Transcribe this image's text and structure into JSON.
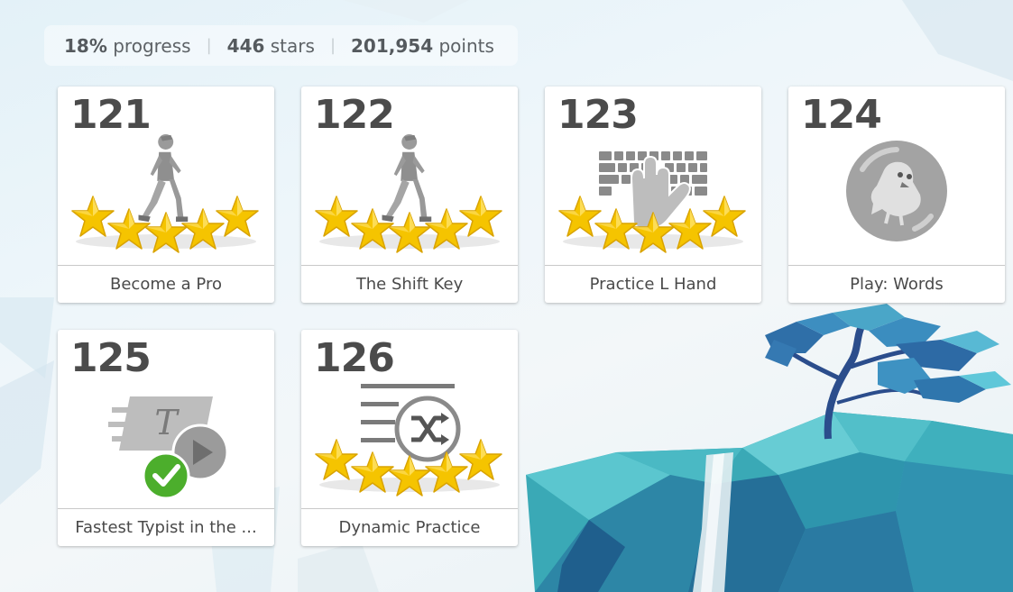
{
  "stats": {
    "progress_value": "18%",
    "progress_label": "progress",
    "stars_value": "446",
    "stars_label": "stars",
    "points_value": "201,954",
    "points_label": "points"
  },
  "lessons": [
    {
      "number": "121",
      "title": "Become a Pro",
      "icon": "walking-person-icon",
      "stars": 5
    },
    {
      "number": "122",
      "title": "The Shift Key",
      "icon": "walking-person-icon",
      "stars": 5
    },
    {
      "number": "123",
      "title": "Practice L Hand",
      "icon": "keyboard-hand-icon",
      "stars": 5
    },
    {
      "number": "124",
      "title": "Play: Words",
      "icon": "game-bird-icon",
      "stars": 0
    },
    {
      "number": "125",
      "title": "Fastest Typist in the ...",
      "icon": "typing-test-video-icon",
      "stars": 0,
      "completed": true
    },
    {
      "number": "126",
      "title": "Dynamic Practice",
      "icon": "shuffle-text-icon",
      "stars": 5
    }
  ],
  "colors": {
    "star": "#f5c400",
    "star_stroke": "#e0a800",
    "icon_gray": "#9a9a9a",
    "check_green": "#4cae2c",
    "cliff_teal": "#3bb3c0",
    "cliff_blue": "#2a6f9e"
  }
}
